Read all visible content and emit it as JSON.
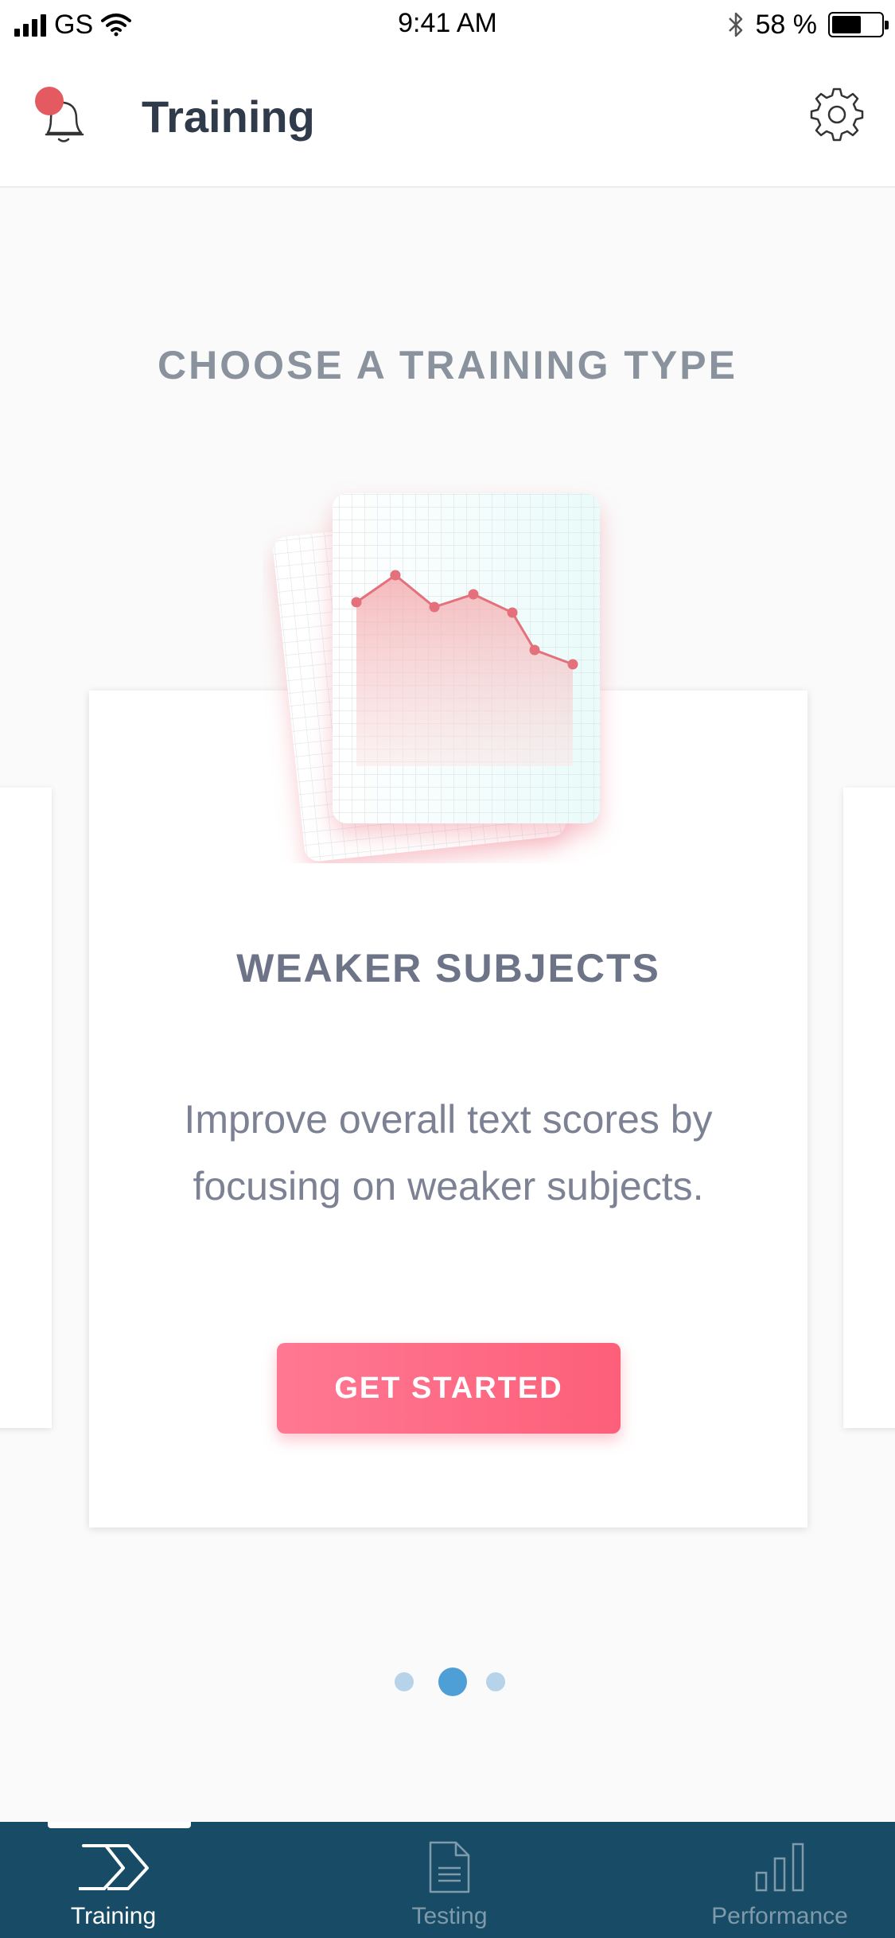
{
  "status_bar": {
    "carrier": "GS",
    "time": "9:41 AM",
    "battery_text": "58 %",
    "battery_level": 0.58
  },
  "header": {
    "title": "Training",
    "notification_icon": "bell-icon",
    "settings_icon": "gear-icon"
  },
  "main": {
    "section_heading": "CHOOSE A TRAINING TYPE",
    "card": {
      "title": "WEAKER SUBJECTS",
      "description": "Improve overall text scores by focusing on weaker subjects.",
      "button_label": "GET STARTED",
      "illustration": "line-chart-cards-illustration"
    },
    "pager": {
      "count": 3,
      "active_index": 1
    }
  },
  "tabbar": {
    "tabs": [
      {
        "label": "Training",
        "icon": "chevron-icon",
        "active": true
      },
      {
        "label": "Testing",
        "icon": "document-icon",
        "active": false
      },
      {
        "label": "Performance",
        "icon": "bar-chart-icon",
        "active": false
      }
    ]
  },
  "colors": {
    "accent": "#FD5F79",
    "tabbar_bg": "#184C66",
    "pager_active": "#4D9FD6",
    "pager_inactive": "#B7D3EA",
    "notification": "#E35A60"
  }
}
